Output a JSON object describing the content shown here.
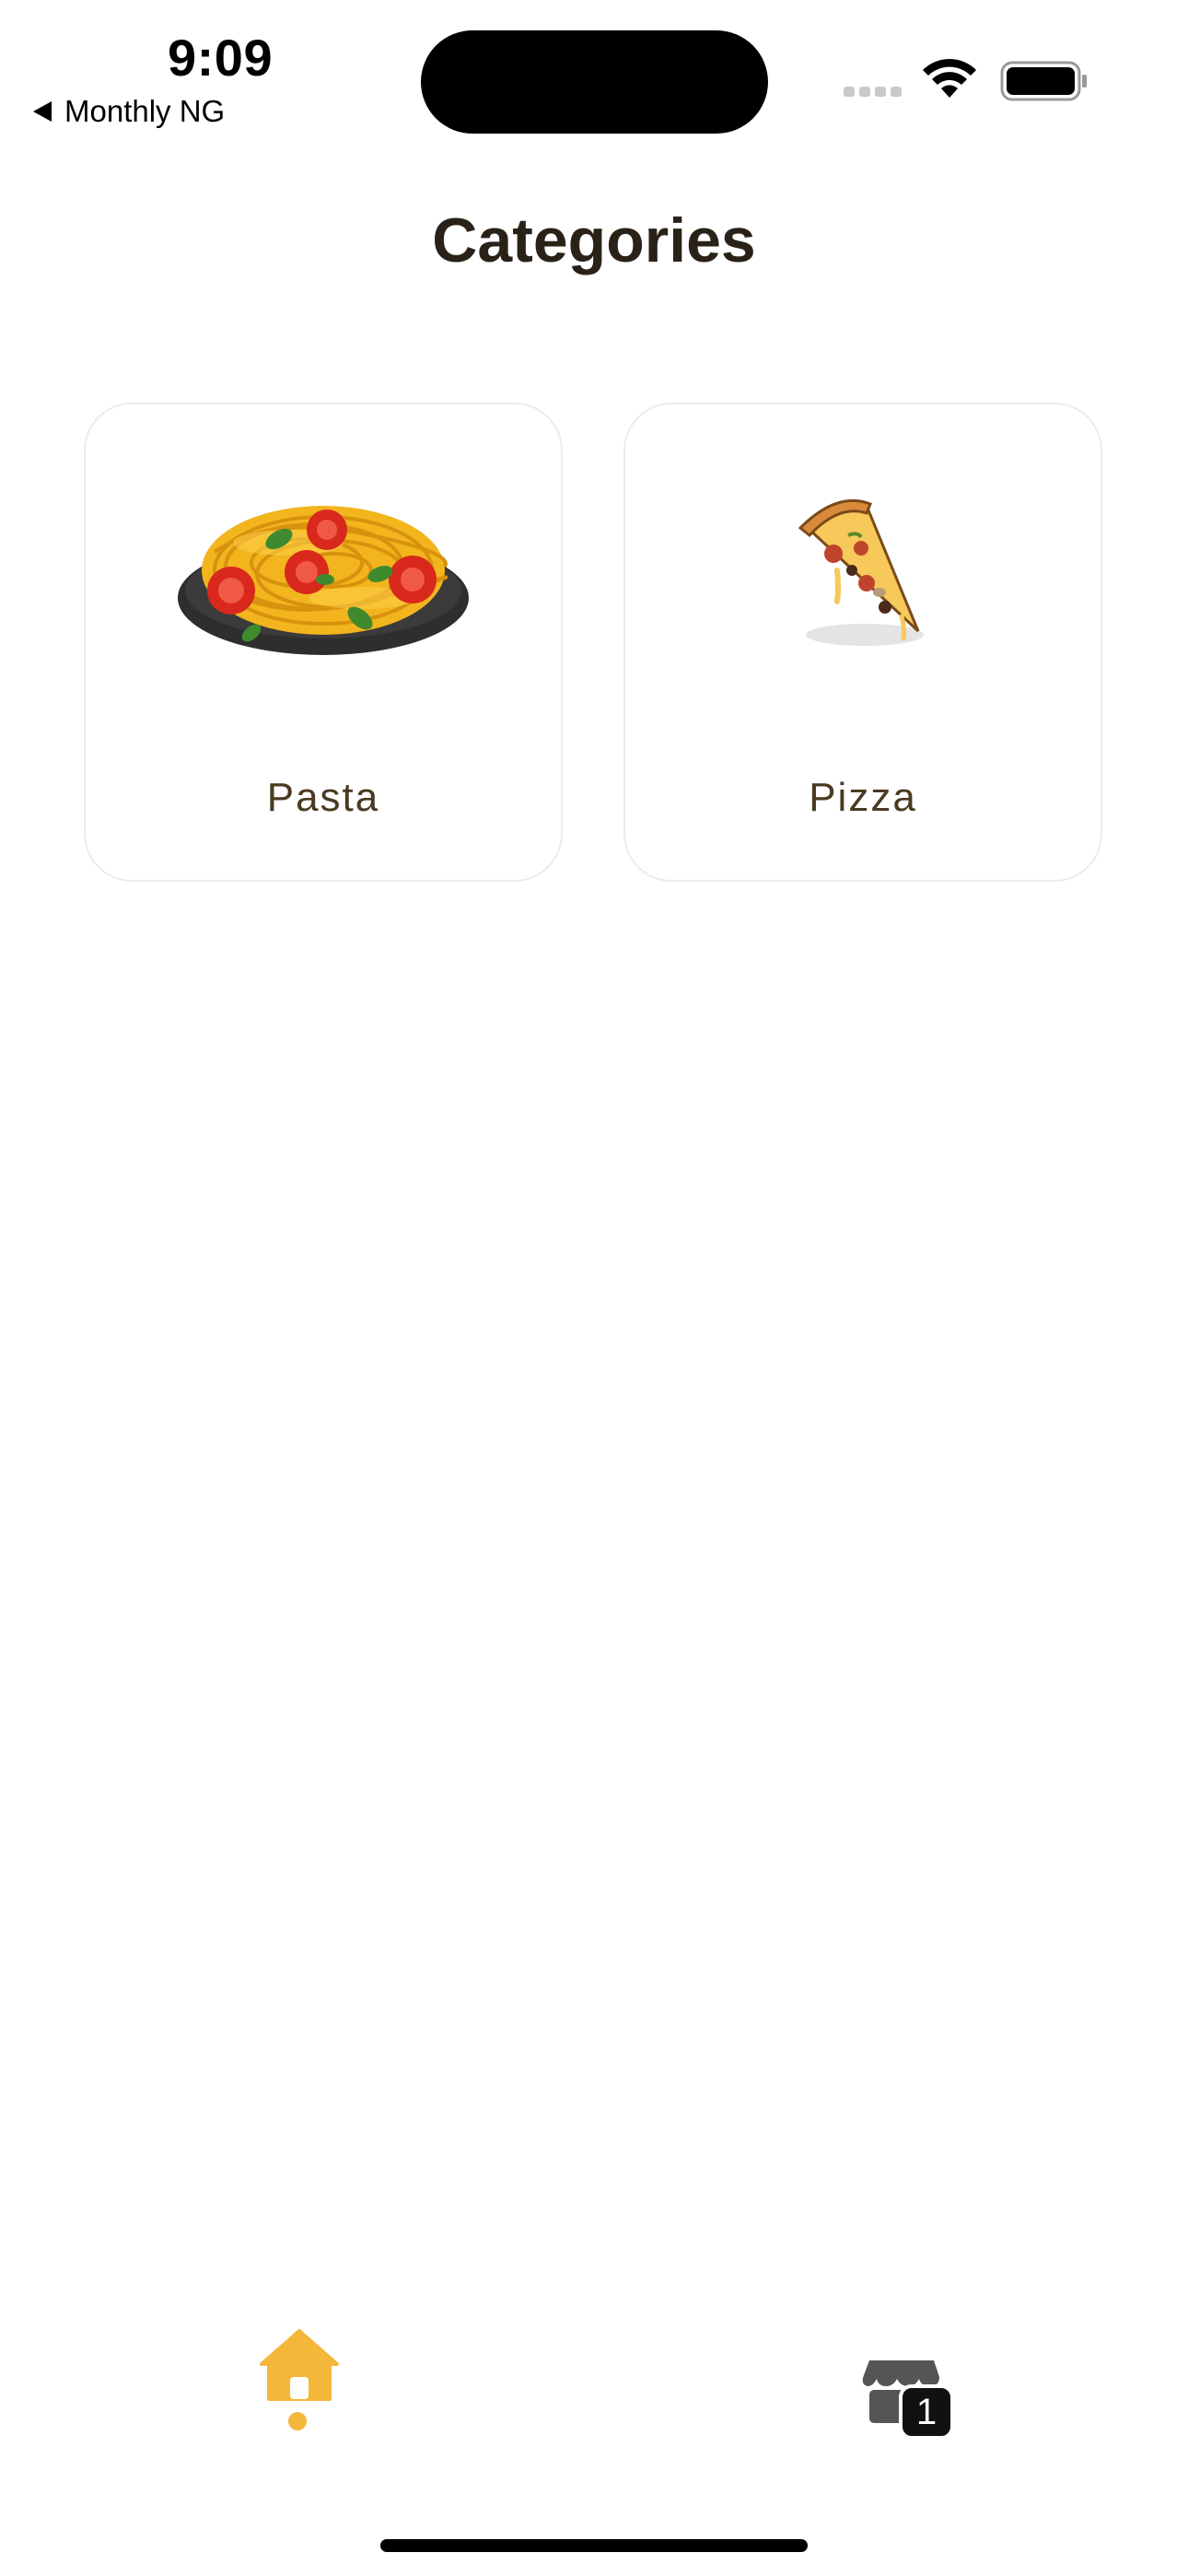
{
  "status_bar": {
    "time": "9:09",
    "back_app": "Monthly NG"
  },
  "header": {
    "title": "Categories"
  },
  "categories": [
    {
      "label": "Pasta",
      "icon": "spaghetti-plate-icon"
    },
    {
      "label": "Pizza",
      "icon": "pizza-slice-icon"
    }
  ],
  "bottom_nav": {
    "items": [
      {
        "icon": "home-icon",
        "active": true
      },
      {
        "icon": "store-icon",
        "active": false
      }
    ],
    "cart_count": "1"
  },
  "colors": {
    "accent": "#f5b73a",
    "title_text": "#2a2218",
    "card_border": "#ececec",
    "badge": "#111111"
  }
}
